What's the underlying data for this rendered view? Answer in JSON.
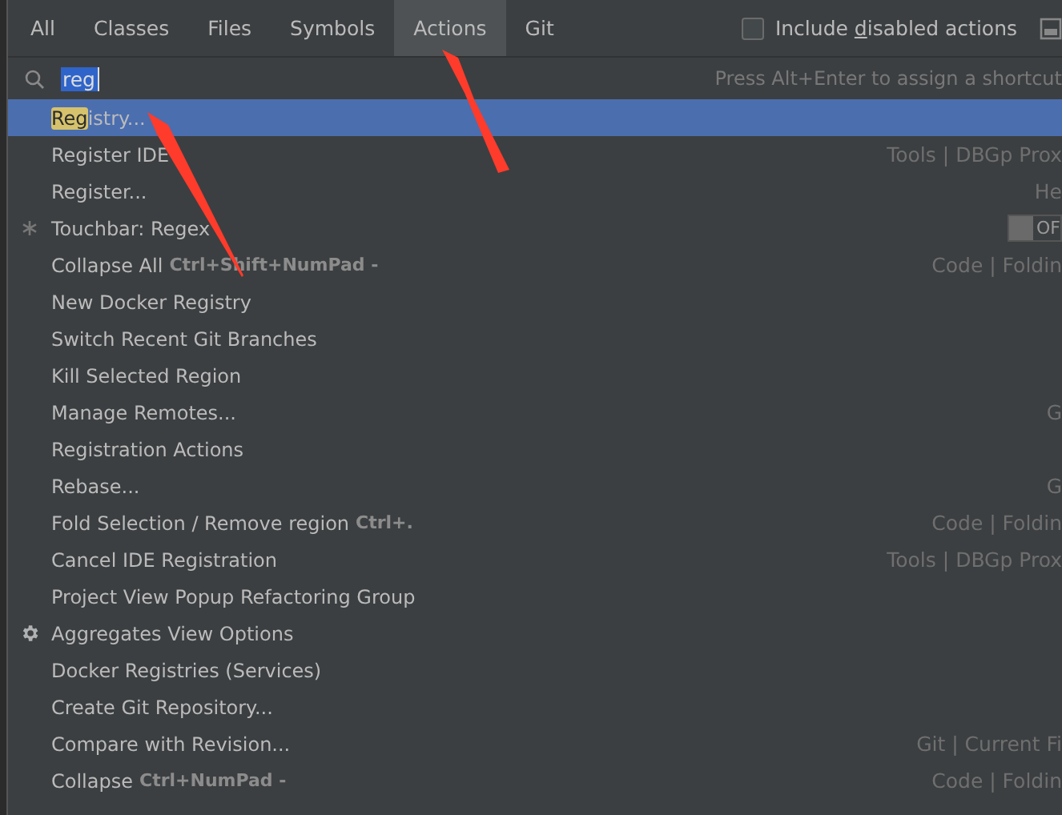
{
  "tabs": [
    {
      "label": "All",
      "selected": false
    },
    {
      "label": "Classes",
      "selected": false
    },
    {
      "label": "Files",
      "selected": false
    },
    {
      "label": "Symbols",
      "selected": false
    },
    {
      "label": "Actions",
      "selected": true
    },
    {
      "label": "Git",
      "selected": false
    }
  ],
  "include_disabled": {
    "before": "Include ",
    "mnemonic": "d",
    "after": "isabled actions",
    "checked": false
  },
  "search": {
    "value": "reg",
    "hint": "Press Alt+Enter to assign a shortcut"
  },
  "results": [
    {
      "kind": "plain",
      "match": "Reg",
      "label": "istry...",
      "selected": true
    },
    {
      "kind": "plain",
      "label": "Register IDE",
      "hint": "Tools | DBGp Prox",
      "selected": false
    },
    {
      "kind": "plain",
      "label": "Register...",
      "hint": "He",
      "selected": false
    },
    {
      "kind": "toggle",
      "label": "Touchbar: Regex",
      "toggle": {
        "on": false,
        "text": "OF"
      },
      "selected": false
    },
    {
      "kind": "plain",
      "label": "Collapse All",
      "shortcut": "Ctrl+Shift+NumPad -",
      "hint": "Code | Foldin",
      "selected": false
    },
    {
      "kind": "plain",
      "label": "New Docker Registry",
      "selected": false
    },
    {
      "kind": "plain",
      "label": "Switch Recent Git Branches",
      "selected": false
    },
    {
      "kind": "plain",
      "label": "Kill Selected Region",
      "selected": false
    },
    {
      "kind": "plain",
      "label": "Manage Remotes...",
      "hint": "G",
      "selected": false
    },
    {
      "kind": "plain",
      "label": "Registration Actions",
      "selected": false
    },
    {
      "kind": "plain",
      "label": "Rebase...",
      "hint": "G",
      "selected": false
    },
    {
      "kind": "plain",
      "label": "Fold Selection / Remove region",
      "shortcut": "Ctrl+.",
      "hint": "Code | Foldin",
      "selected": false
    },
    {
      "kind": "plain",
      "label": "Cancel IDE Registration",
      "hint": "Tools | DBGp Prox",
      "selected": false
    },
    {
      "kind": "plain",
      "label": "Project View Popup Refactoring Group",
      "selected": false
    },
    {
      "kind": "gear",
      "label": "Aggregates View Options",
      "selected": false
    },
    {
      "kind": "plain",
      "label": "Docker Registries (Services)",
      "selected": false
    },
    {
      "kind": "plain",
      "label": "Create Git Repository...",
      "selected": false
    },
    {
      "kind": "plain",
      "label": "Compare with Revision...",
      "hint": "Git | Current Fi",
      "selected": false
    },
    {
      "kind": "plain",
      "label": "Collapse",
      "shortcut": "Ctrl+NumPad -",
      "hint": "Code | Foldin",
      "selected": false
    }
  ]
}
